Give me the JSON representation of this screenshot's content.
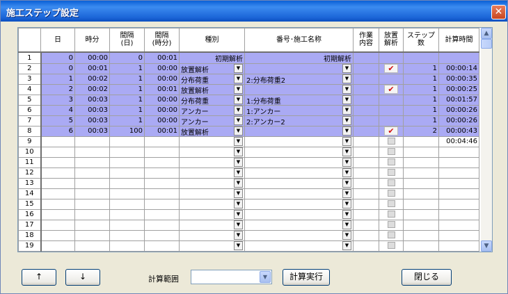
{
  "window": {
    "title": "施工ステップ設定",
    "close_icon": "close-icon"
  },
  "grid": {
    "headers": [
      "日",
      "時分",
      "間隔\n(日)",
      "間隔\n(時分)",
      "種別",
      "番号･施工名称",
      "作業\n内容",
      "放置\n解析",
      "ステップ\n数",
      "計算時間"
    ],
    "rows": [
      {
        "n": "1",
        "day": "0",
        "hm": "00:00",
        "iday": "0",
        "ihm": "00:01",
        "kind": "初期解析",
        "name": "初期解析",
        "work": "",
        "check": "none",
        "steps": "",
        "time": "",
        "sel": true,
        "kind_dd": false,
        "name_dd": false,
        "kind_align": "right",
        "name_align": "right"
      },
      {
        "n": "2",
        "day": "0",
        "hm": "00:01",
        "iday": "1",
        "ihm": "00:00",
        "kind": "放置解析",
        "name": "",
        "work": "",
        "check": "on",
        "steps": "1",
        "time": "00:00:14",
        "sel": true,
        "kind_dd": true,
        "name_dd": true
      },
      {
        "n": "3",
        "day": "1",
        "hm": "00:02",
        "iday": "1",
        "ihm": "00:00",
        "kind": "分布荷重",
        "name": "2:分布荷重2",
        "work": "",
        "check": "none",
        "steps": "1",
        "time": "00:00:35",
        "sel": true,
        "kind_dd": true,
        "name_dd": true
      },
      {
        "n": "4",
        "day": "2",
        "hm": "00:02",
        "iday": "1",
        "ihm": "00:01",
        "kind": "放置解析",
        "name": "",
        "work": "",
        "check": "on",
        "steps": "1",
        "time": "00:00:25",
        "sel": true,
        "kind_dd": true,
        "name_dd": true
      },
      {
        "n": "5",
        "day": "3",
        "hm": "00:03",
        "iday": "1",
        "ihm": "00:00",
        "kind": "分布荷重",
        "name": "1:分布荷重",
        "work": "",
        "check": "none",
        "steps": "1",
        "time": "00:01:57",
        "sel": true,
        "kind_dd": true,
        "name_dd": true
      },
      {
        "n": "6",
        "day": "4",
        "hm": "00:03",
        "iday": "1",
        "ihm": "00:00",
        "kind": "アンカー",
        "name": "1:アンカー",
        "work": "",
        "check": "none",
        "steps": "1",
        "time": "00:00:26",
        "sel": true,
        "kind_dd": true,
        "name_dd": true
      },
      {
        "n": "7",
        "day": "5",
        "hm": "00:03",
        "iday": "1",
        "ihm": "00:00",
        "kind": "アンカー",
        "name": "2:アンカー2",
        "work": "",
        "check": "none",
        "steps": "1",
        "time": "00:00:26",
        "sel": true,
        "kind_dd": true,
        "name_dd": true
      },
      {
        "n": "8",
        "day": "6",
        "hm": "00:03",
        "iday": "100",
        "ihm": "00:01",
        "kind": "放置解析",
        "name": "",
        "work": "",
        "check": "on",
        "steps": "2",
        "time": "00:00:43",
        "sel": true,
        "kind_dd": true,
        "name_dd": true
      },
      {
        "n": "9",
        "day": "",
        "hm": "",
        "iday": "",
        "ihm": "",
        "kind": "",
        "name": "",
        "work": "",
        "check": "off",
        "steps": "",
        "time": "00:04:46",
        "sel": false,
        "kind_dd": true,
        "name_dd": true
      },
      {
        "n": "10",
        "day": "",
        "hm": "",
        "iday": "",
        "ihm": "",
        "kind": "",
        "name": "",
        "work": "",
        "check": "off",
        "steps": "",
        "time": "",
        "sel": false,
        "kind_dd": true,
        "name_dd": true
      },
      {
        "n": "11",
        "day": "",
        "hm": "",
        "iday": "",
        "ihm": "",
        "kind": "",
        "name": "",
        "work": "",
        "check": "off",
        "steps": "",
        "time": "",
        "sel": false,
        "kind_dd": true,
        "name_dd": true
      },
      {
        "n": "12",
        "day": "",
        "hm": "",
        "iday": "",
        "ihm": "",
        "kind": "",
        "name": "",
        "work": "",
        "check": "off",
        "steps": "",
        "time": "",
        "sel": false,
        "kind_dd": true,
        "name_dd": true
      },
      {
        "n": "13",
        "day": "",
        "hm": "",
        "iday": "",
        "ihm": "",
        "kind": "",
        "name": "",
        "work": "",
        "check": "off",
        "steps": "",
        "time": "",
        "sel": false,
        "kind_dd": true,
        "name_dd": true
      },
      {
        "n": "14",
        "day": "",
        "hm": "",
        "iday": "",
        "ihm": "",
        "kind": "",
        "name": "",
        "work": "",
        "check": "off",
        "steps": "",
        "time": "",
        "sel": false,
        "kind_dd": true,
        "name_dd": true
      },
      {
        "n": "15",
        "day": "",
        "hm": "",
        "iday": "",
        "ihm": "",
        "kind": "",
        "name": "",
        "work": "",
        "check": "off",
        "steps": "",
        "time": "",
        "sel": false,
        "kind_dd": true,
        "name_dd": true
      },
      {
        "n": "16",
        "day": "",
        "hm": "",
        "iday": "",
        "ihm": "",
        "kind": "",
        "name": "",
        "work": "",
        "check": "off",
        "steps": "",
        "time": "",
        "sel": false,
        "kind_dd": true,
        "name_dd": true
      },
      {
        "n": "17",
        "day": "",
        "hm": "",
        "iday": "",
        "ihm": "",
        "kind": "",
        "name": "",
        "work": "",
        "check": "off",
        "steps": "",
        "time": "",
        "sel": false,
        "kind_dd": true,
        "name_dd": true
      },
      {
        "n": "18",
        "day": "",
        "hm": "",
        "iday": "",
        "ihm": "",
        "kind": "",
        "name": "",
        "work": "",
        "check": "off",
        "steps": "",
        "time": "",
        "sel": false,
        "kind_dd": true,
        "name_dd": true
      },
      {
        "n": "19",
        "day": "",
        "hm": "",
        "iday": "",
        "ihm": "",
        "kind": "",
        "name": "",
        "work": "",
        "check": "off",
        "steps": "",
        "time": "",
        "sel": false,
        "kind_dd": true,
        "name_dd": true
      }
    ],
    "selection_color": "#aaaaf4",
    "check_mark": "✔"
  },
  "scrollbar": {
    "up_icon": "▲",
    "down_icon": "▼"
  },
  "footer": {
    "up_label": "↑",
    "down_label": "↓",
    "range_label": "計算範囲",
    "range_value": "",
    "combo_arrow": "▼",
    "run_label": "計算実行",
    "close_label": "閉じる"
  }
}
